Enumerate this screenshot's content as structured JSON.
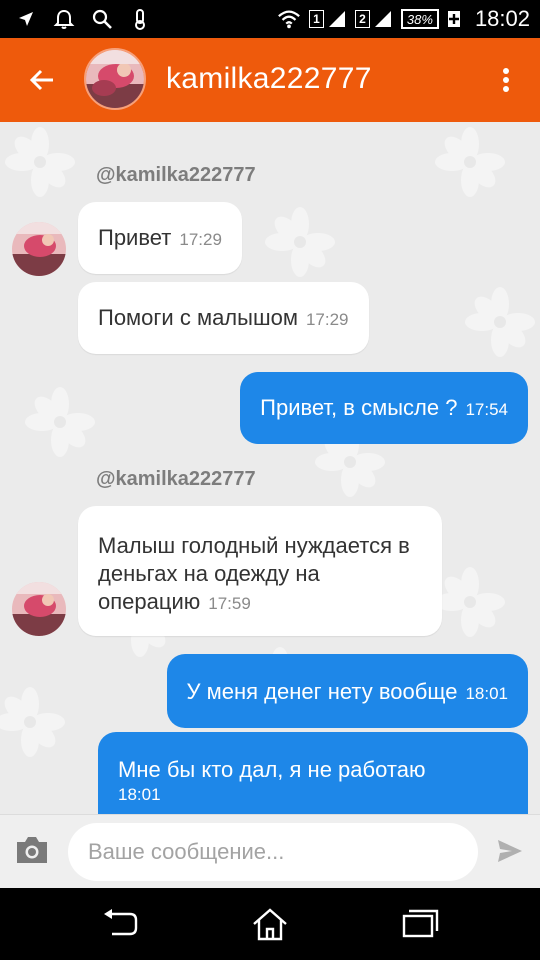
{
  "status_bar": {
    "sim1": "1",
    "sim2": "2",
    "battery": "38%",
    "time": "18:02",
    "icons": [
      "navigation-icon",
      "alarm-icon",
      "search-icon",
      "temperature-icon",
      "wifi-icon",
      "signal-icon",
      "battery-icon"
    ]
  },
  "header": {
    "contact_name": "kamilka222777",
    "accent_color": "#ee5a0c"
  },
  "messages": [
    {
      "type": "author",
      "text": "@kamilka222777"
    },
    {
      "type": "in",
      "text": "Привет",
      "time": "17:29"
    },
    {
      "type": "in",
      "text": "Помоги с малышом",
      "time": "17:29"
    },
    {
      "type": "out",
      "text": "Привет, в смысле ?",
      "time": "17:54"
    },
    {
      "type": "author",
      "text": "@kamilka222777"
    },
    {
      "type": "in",
      "text": "Малыш голодный нуждается в деньгах на одежду на операцию",
      "time": "17:59"
    },
    {
      "type": "out",
      "text": "У меня денег нету вообще",
      "time": "18:01"
    },
    {
      "type": "out",
      "text": "Мне бы кто дал, я не работаю",
      "time": "18:01"
    }
  ],
  "colors": {
    "outgoing_bubble": "#1e87e8",
    "incoming_bubble": "#ffffff",
    "chat_background": "#ebebeb"
  },
  "composer": {
    "placeholder": "Ваше сообщение..."
  },
  "nav_bar": {
    "buttons": [
      "back-nav-icon",
      "home-nav-icon",
      "recents-nav-icon"
    ]
  }
}
